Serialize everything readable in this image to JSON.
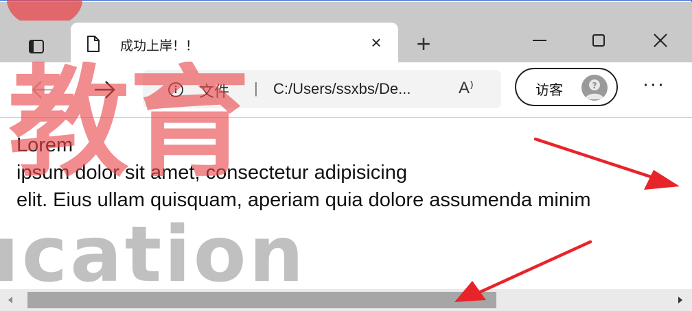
{
  "tab": {
    "title": "成功上岸！！",
    "close_glyph": "×"
  },
  "tabstrip": {
    "new_tab_glyph": "+"
  },
  "address_bar": {
    "file_label": "文件",
    "separator": "|",
    "url": "C:/Users/ssxbs/De...",
    "read_aloud_glyph": "A⁾"
  },
  "profile": {
    "label": "访客"
  },
  "menu": {
    "more_glyph": "···"
  },
  "page": {
    "lines": [
      "Lorem",
      "ipsum dolor sit amet, consectetur adipisicing",
      "elit. Eius ullam quisquam, aperiam quia dolore assumenda minim"
    ]
  },
  "watermark": {
    "chinese": "教育",
    "latin": "ucation"
  },
  "scrollbar": {
    "horizontal_position": 0.55
  },
  "colors": {
    "frame_border": "#3b6fd6",
    "watermark_red": "#e8454a",
    "annotation_arrow": "#e8242a",
    "tabstrip_bg": "#c9c9c9"
  }
}
